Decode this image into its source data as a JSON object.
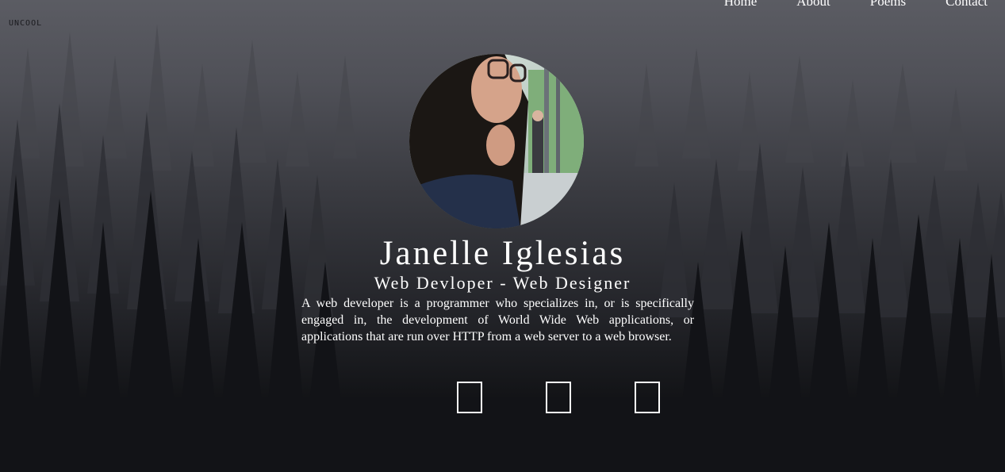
{
  "brand": {
    "logo_text": "UNCOOL"
  },
  "nav": [
    {
      "label": "Home"
    },
    {
      "label": "About"
    },
    {
      "label": "Poems"
    },
    {
      "label": "Contact"
    }
  ],
  "profile": {
    "name": "Janelle Iglesias",
    "subtitle": "Web Devloper - Web Designer",
    "bio": "A web developer is a programmer who specializes in, or is specifically engaged in, the development of World Wide Web applications, or applications that are run over HTTP from a web server to a web browser."
  },
  "social": [
    {
      "icon": "social-icon-placeholder"
    },
    {
      "icon": "social-icon-placeholder"
    },
    {
      "icon": "social-icon-placeholder"
    }
  ],
  "colors": {
    "text": "#ffffff",
    "background_top": "#5b5c63",
    "background_bottom": "#0c0d10"
  }
}
